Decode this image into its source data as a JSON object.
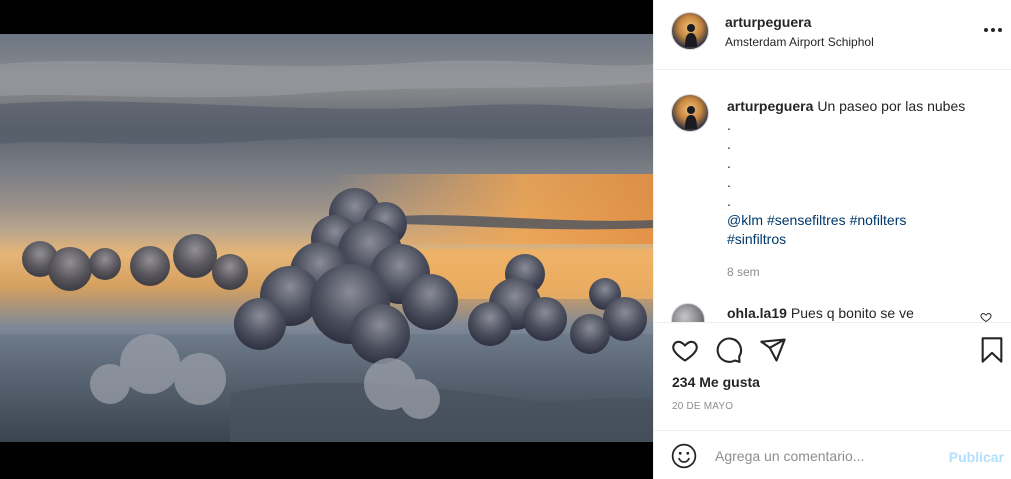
{
  "post": {
    "username": "arturpeguera",
    "location": "Amsterdam Airport Schiphol",
    "more_icon": "more-horizontal-icon",
    "photo_alt": "Clouds over the sea at sunset from an airplane"
  },
  "caption": {
    "username": "arturpeguera",
    "text": "Un paseo por las nubes",
    "dots": [
      ".",
      ".",
      ".",
      ".",
      "."
    ],
    "tags": [
      "@klm",
      "#sensefiltres",
      "#nofilters",
      "#sinfiltros"
    ],
    "age": "8 sem"
  },
  "comments": [
    {
      "username": "ohla.la19",
      "text": "Pues q bonito se ve"
    }
  ],
  "actions": {
    "like_icon": "heart-icon",
    "comment_icon": "comment-icon",
    "share_icon": "share-icon",
    "save_icon": "bookmark-icon"
  },
  "likes": "234 Me gusta",
  "date": "20 DE MAYO",
  "add_comment": {
    "placeholder": "Agrega un comentario...",
    "publish_label": "Publicar",
    "emoji_icon": "emoji-icon"
  },
  "colors": {
    "text": "#262626",
    "secondary": "#8e8e8e",
    "link": "#00376b",
    "publish_disabled": "#b2dffc",
    "border": "#efefef"
  }
}
